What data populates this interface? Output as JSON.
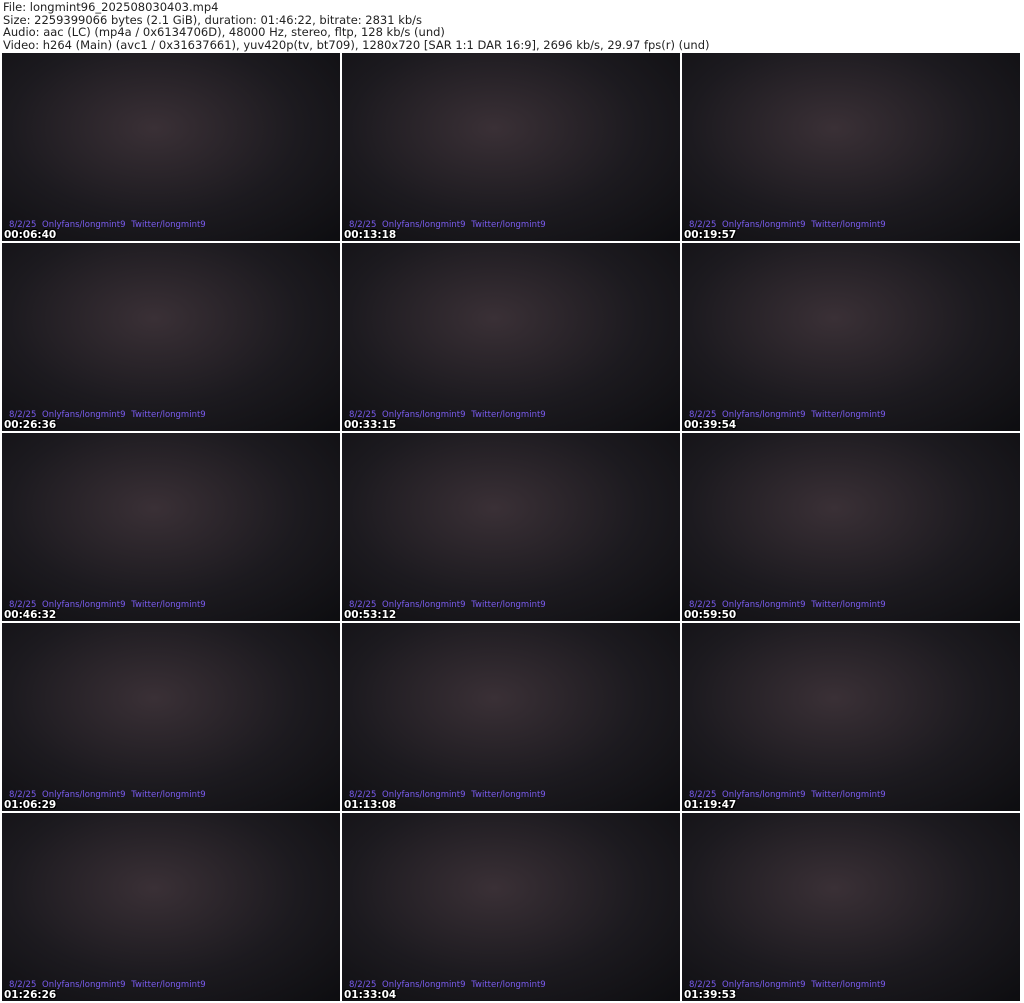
{
  "header": {
    "file": "File: longmint96_202508030403.mp4",
    "size": "Size: 2259399066 bytes (2.1 GiB), duration: 01:46:22, bitrate: 2831 kb/s",
    "audio": "Audio: aac (LC) (mp4a / 0x6134706D), 48000 Hz, stereo, fltp, 128 kb/s (und)",
    "video": "Video: h264 (Main) (avc1 / 0x31637661), yuv420p(tv, bt709), 1280x720 [SAR 1:1 DAR 16:9], 2696 kb/s, 29.97 fps(r) (und)"
  },
  "watermark": "8/2/25  Onlyfans/longmint9  Twitter/longmint9",
  "thumbnails": [
    "00:06:40",
    "00:13:18",
    "00:19:57",
    "00:26:36",
    "00:33:15",
    "00:39:54",
    "00:46:32",
    "00:53:12",
    "00:59:50",
    "01:06:29",
    "01:13:08",
    "01:19:47",
    "01:26:26",
    "01:33:04",
    "01:39:53"
  ]
}
